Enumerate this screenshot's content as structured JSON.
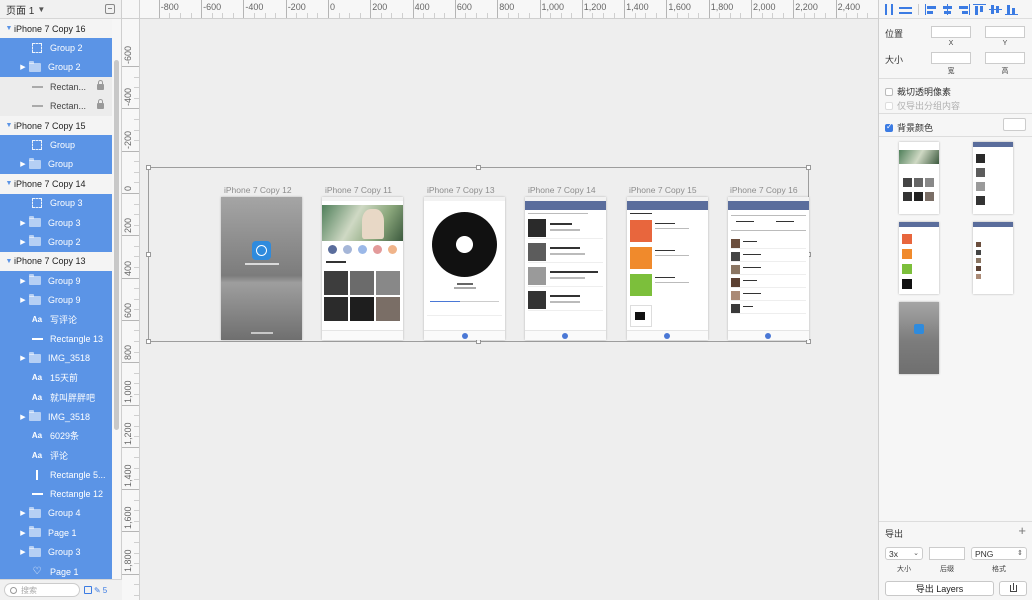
{
  "page_selector": {
    "label": "页面 1"
  },
  "layers": [
    {
      "name": "iPhone 7 Copy 16",
      "type": "artboard"
    },
    {
      "name": "Group 2",
      "type": "slice",
      "indent": 2,
      "sel": true
    },
    {
      "name": "Group 2",
      "type": "group",
      "indent": 1,
      "sel": true
    },
    {
      "name": "Rectan...",
      "type": "rect",
      "indent": 2,
      "locked": true
    },
    {
      "name": "Rectan...",
      "type": "rect",
      "indent": 2,
      "locked": true
    },
    {
      "name": "iPhone 7 Copy 15",
      "type": "artboard"
    },
    {
      "name": "Group",
      "type": "slice",
      "indent": 2,
      "sel": true
    },
    {
      "name": "Group",
      "type": "group",
      "indent": 1,
      "sel": true
    },
    {
      "name": "iPhone 7 Copy 14",
      "type": "artboard"
    },
    {
      "name": "Group 3",
      "type": "slice",
      "indent": 2,
      "sel": true
    },
    {
      "name": "Group 3",
      "type": "group",
      "indent": 1,
      "sel": true
    },
    {
      "name": "Group 2",
      "type": "group",
      "indent": 1,
      "sel": true
    },
    {
      "name": "iPhone 7 Copy 13",
      "type": "artboard"
    },
    {
      "name": "Group 9",
      "type": "group",
      "indent": 1,
      "sel": true
    },
    {
      "name": "Group 9",
      "type": "group",
      "indent": 1,
      "sel": true
    },
    {
      "name": "写评论",
      "type": "text",
      "indent": 2,
      "sel": true
    },
    {
      "name": "Rectangle 13",
      "type": "rect",
      "indent": 2,
      "sel": true
    },
    {
      "name": "IMG_3518",
      "type": "group",
      "indent": 1,
      "sel": true
    },
    {
      "name": "15天前",
      "type": "text",
      "indent": 2,
      "sel": true
    },
    {
      "name": "就叫胖胖吧",
      "type": "text",
      "indent": 2,
      "sel": true
    },
    {
      "name": "IMG_3518",
      "type": "group",
      "indent": 1,
      "sel": true
    },
    {
      "name": "6029条",
      "type": "text",
      "indent": 2,
      "sel": true
    },
    {
      "name": "评论",
      "type": "text",
      "indent": 2,
      "sel": true
    },
    {
      "name": "Rectangle 5...",
      "type": "vline",
      "indent": 2,
      "sel": true
    },
    {
      "name": "Rectangle 12",
      "type": "rect",
      "indent": 2,
      "sel": true
    },
    {
      "name": "Group 4",
      "type": "group",
      "indent": 1,
      "sel": true
    },
    {
      "name": "Page 1",
      "type": "group",
      "indent": 1,
      "sel": true
    },
    {
      "name": "Group 3",
      "type": "group",
      "indent": 1,
      "sel": true
    },
    {
      "name": "Page 1",
      "type": "heart",
      "indent": 2,
      "sel": true
    }
  ],
  "search": {
    "placeholder": "搜索"
  },
  "footer_count": "5",
  "ruler_top": [
    "-800",
    "-600",
    "-400",
    "-200",
    "0",
    "200",
    "400",
    "600",
    "800",
    "1,000",
    "1,200",
    "1,400",
    "1,600",
    "1,800",
    "2,000",
    "2,200",
    "2,400"
  ],
  "ruler_left": [
    "-600",
    "-400",
    "-200",
    "0",
    "200",
    "400",
    "600",
    "800",
    "1,000",
    "1,200",
    "1,400",
    "1,600",
    "1,800"
  ],
  "artboards": [
    "iPhone 7 Copy 12",
    "iPhone 7 Copy 11",
    "iPhone 7 Copy 13",
    "iPhone 7 Copy 14",
    "iPhone 7 Copy 15",
    "iPhone 7 Copy 16"
  ],
  "inspector": {
    "position_label": "位置",
    "size_label": "大小",
    "x_label": "X",
    "y_label": "Y",
    "width_label": "宽",
    "height_label": "高",
    "trim_label": "裁切透明像素",
    "export_group_label": "仅导出分组内容",
    "bg_color_label": "背景颜色"
  },
  "export": {
    "title": "导出",
    "scale": "3x",
    "scale_label": "大小",
    "suffix_label": "后缀",
    "format": "PNG",
    "format_label": "格式",
    "button": "导出 Layers"
  },
  "colors": {
    "selection": "#5b94e6",
    "accent": "#3b7be3",
    "nav": "#5a6d9c"
  }
}
